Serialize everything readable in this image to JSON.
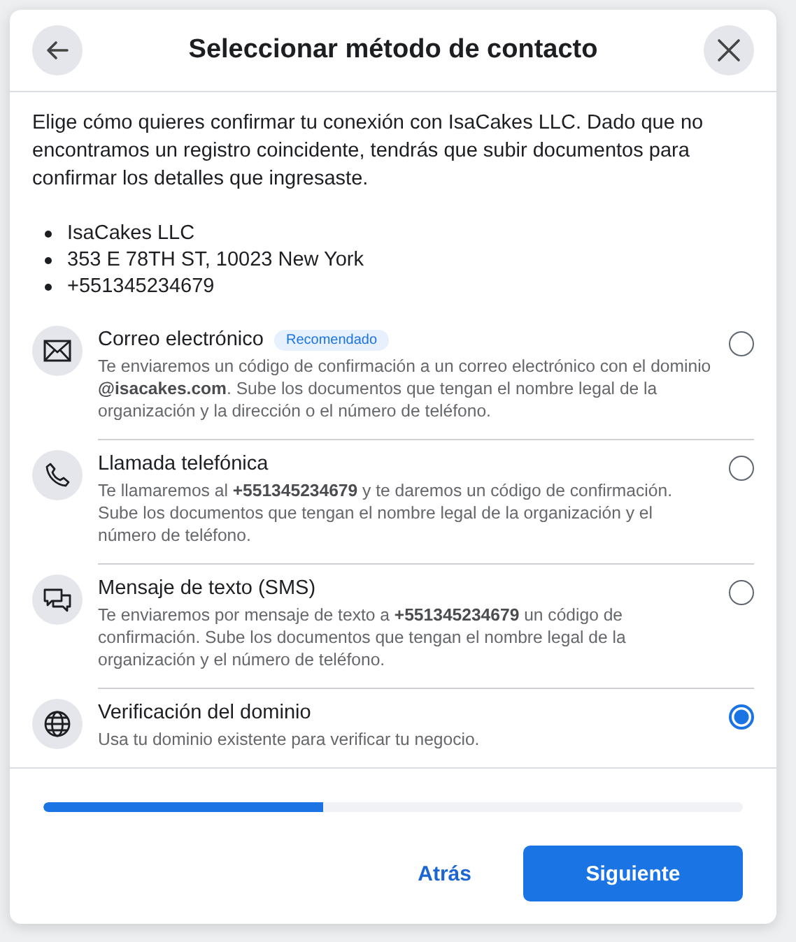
{
  "dialog": {
    "title": "Seleccionar método de contacto"
  },
  "intro": "Elige cómo quieres confirmar tu conexión con IsaCakes LLC. Dado que no encontramos un registro coincidente, tendrás que subir documentos para confirmar los detalles que ingresaste.",
  "details": [
    "IsaCakes LLC",
    "353 E 78TH ST, 10023 New York",
    "+551345234679"
  ],
  "options": [
    {
      "kind": "email",
      "title": "Correo electrónico",
      "badge": "Recomendado",
      "description": "Te enviaremos un código de confirmación a un correo electrónico con el dominio **@isacakes.com**. Sube los documentos que tengan el nombre legal de la organización y la dirección o el número de teléfono.",
      "selected": false
    },
    {
      "kind": "phone",
      "title": "Llamada telefónica",
      "description": "Te llamaremos al **+551345234679** y te daremos un código de confirmación. Sube los documentos que tengan el nombre legal de la organización y el número de teléfono.",
      "selected": false
    },
    {
      "kind": "sms",
      "title": "Mensaje de texto (SMS)",
      "description": "Te enviaremos por mensaje de texto a **+551345234679** un código de confirmación. Sube los documentos que tengan el nombre legal de la organización y el número de teléfono.",
      "selected": false
    },
    {
      "kind": "domain",
      "title": "Verificación del dominio",
      "description": "Usa tu dominio existente para verificar tu negocio.",
      "selected": true
    }
  ],
  "progress": {
    "level": 0.4
  },
  "buttons": {
    "back": "Atrás",
    "next": "Siguiente"
  }
}
